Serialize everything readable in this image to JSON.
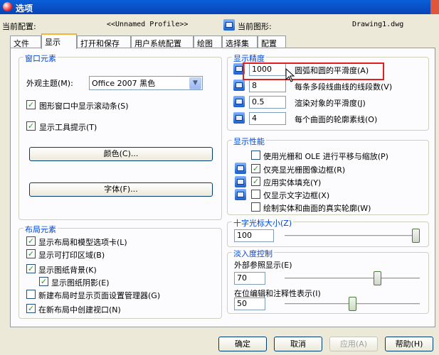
{
  "window": {
    "title": "选项"
  },
  "header": {
    "current_profile_label": "当前配置:",
    "current_profile_value": "<<Unnamed Profile>>",
    "current_drawing_label": "当前图形:",
    "current_drawing_value": "Drawing1.dwg"
  },
  "tabs": [
    {
      "label": "文件"
    },
    {
      "label": "显示"
    },
    {
      "label": "打开和保存"
    },
    {
      "label": "用户系统配置"
    },
    {
      "label": "绘图"
    },
    {
      "label": "选择集"
    },
    {
      "label": "配置"
    }
  ],
  "window_elements": {
    "title": "窗口元素",
    "color_scheme_label": "外观主题(M):",
    "color_scheme_value": "Office 2007 黑色",
    "show_scrollbars": "图形窗口中显示滚动条(S)",
    "show_tooltips": "显示工具提示(T)",
    "colors_button": "颜色(C)...",
    "fonts_button": "字体(F)..."
  },
  "layout_elements": {
    "title": "布局元素",
    "items": [
      {
        "label": "显示布局和模型选项卡(L)",
        "checked": true
      },
      {
        "label": "显示可打印区域(B)",
        "checked": true
      },
      {
        "label": "显示图纸背景(K)",
        "checked": true
      },
      {
        "label": "显示图纸阴影(E)",
        "checked": true
      },
      {
        "label": "新建布局时显示页面设置管理器(G)",
        "checked": false
      },
      {
        "label": "在新布局中创建视口(N)",
        "checked": true
      }
    ]
  },
  "display_resolution": {
    "title": "显示精度",
    "rows": [
      {
        "value": "1000",
        "label": "圆弧和圆的平滑度(A)"
      },
      {
        "value": "8",
        "label": "每条多段线曲线的线段数(V)"
      },
      {
        "value": "0.5",
        "label": "渲染对象的平滑度(J)"
      },
      {
        "value": "4",
        "label": "每个曲面的轮廓素线(O)"
      }
    ]
  },
  "display_performance": {
    "title": "显示性能",
    "items": [
      {
        "label": "使用光栅和 OLE 进行平移与缩放(P)",
        "checked": false
      },
      {
        "label": "仅亮显光栅图像边框(R)",
        "checked": true
      },
      {
        "label": "应用实体填充(Y)",
        "checked": true
      },
      {
        "label": "仅显示文字边框(X)",
        "checked": false
      },
      {
        "label": "绘制实体和曲面的真实轮廓(W)",
        "checked": false
      }
    ]
  },
  "crosshair": {
    "title": "十字光标大小(Z)",
    "value": "100",
    "slider_fraction": 1.0
  },
  "fade_control": {
    "title": "淡入度控制",
    "xref_label": "外部参照显示(E)",
    "xref_value": "70",
    "xref_fraction": 0.7,
    "inplace_label": "在位编辑和注释性表示(I)",
    "inplace_value": "50",
    "inplace_fraction": 0.5
  },
  "footer": {
    "ok": "确定",
    "cancel": "取消",
    "apply": "应用(A)",
    "help": "帮助(H)"
  }
}
